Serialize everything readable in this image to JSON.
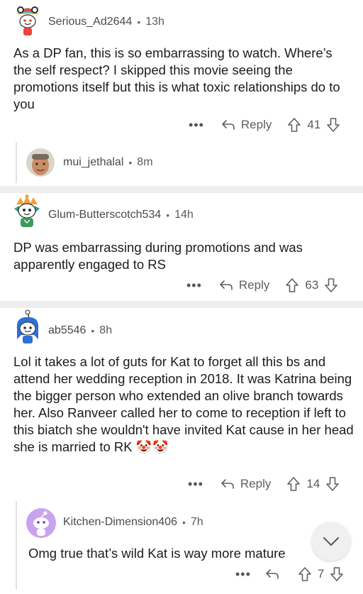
{
  "comments": [
    {
      "username": "Serious_Ad2644",
      "time": "13h",
      "text": "As a DP fan, this is so embarrassing to watch. Where’s the self respect? I skipped this movie seeing the promotions itself but this is what toxic relationships do to you",
      "reply_label": "Reply",
      "score": "41",
      "avatar_icon": "snoo-avatar-rainbow-hat-icon",
      "reply": {
        "username": "mui_jethalal",
        "time": "8m",
        "avatar_icon": "profile-photo-avatar"
      }
    },
    {
      "username": "Glum-Butterscotch534",
      "time": "14h",
      "text": "DP was embarrassing during promotions and was apparently engaged to RS",
      "reply_label": "Reply",
      "score": "63",
      "avatar_icon": "snoo-avatar-dragon-icon"
    },
    {
      "username": "ab5546",
      "time": "8h",
      "text": "Lol it takes a lot of guts for Kat to forget all this bs and attend her wedding reception in 2018. It was Katrina being the bigger person who extended an olive branch towards her. Also Ranveer called her to come to reception if left to this biatch she wouldn't have invited Kat cause in her head she is married to RK",
      "emoji": "🤡🤡",
      "reply_label": "Reply",
      "score": "14",
      "avatar_icon": "snoo-avatar-blue-hair-icon",
      "reply": {
        "username": "Kitchen-Dimension406",
        "time": "7h",
        "text": "Omg true that’s wild Kat is way more mature",
        "score": "7",
        "avatar_icon": "snoo-avatar-purple-icon"
      }
    }
  ],
  "colors": {
    "separator": "#eeeeee",
    "text": "#1c1c1c",
    "meta": "#5b5b5b",
    "avatar_purple": "#c8a4f0"
  },
  "fab_icon": "chevron-down-icon"
}
